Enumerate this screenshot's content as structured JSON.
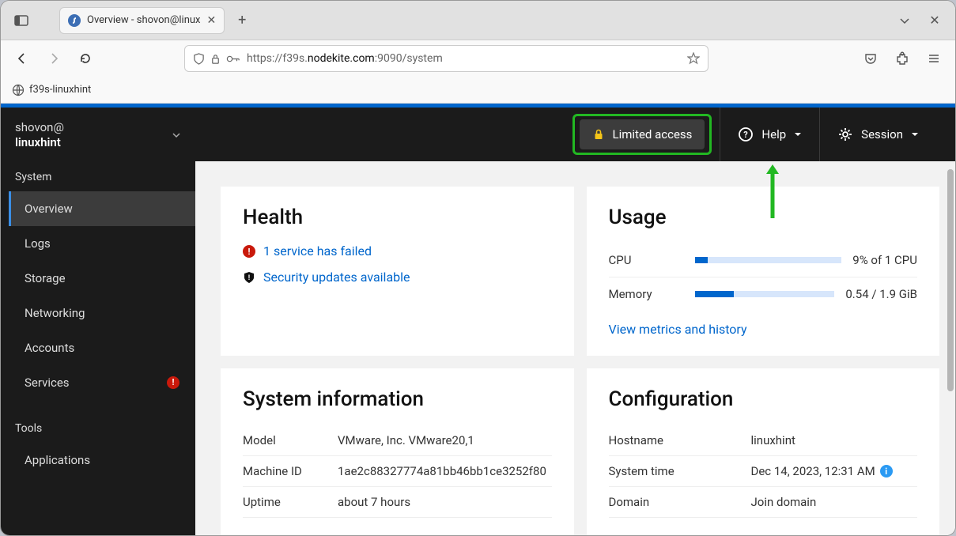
{
  "browser": {
    "tab_title": "Overview - shovon@linux",
    "url_prefix": "https://f39s.",
    "url_host": "nodekite.com",
    "url_suffix": ":9090/system",
    "bookmark": "f39s-linuxhint"
  },
  "sidebar": {
    "user_line1": "shovon@",
    "user_line2": "linuxhint",
    "section_system": "System",
    "items": [
      {
        "label": "Overview"
      },
      {
        "label": "Logs"
      },
      {
        "label": "Storage"
      },
      {
        "label": "Networking"
      },
      {
        "label": "Accounts"
      },
      {
        "label": "Services",
        "badge": "!"
      }
    ],
    "section_tools": "Tools",
    "tools": [
      {
        "label": "Applications"
      }
    ]
  },
  "topbar": {
    "limited": "Limited access",
    "help": "Help",
    "session": "Session"
  },
  "health": {
    "title": "Health",
    "failed": "1 service has failed",
    "security": "Security updates available"
  },
  "usage": {
    "title": "Usage",
    "cpu_label": "CPU",
    "cpu_value": "9% of 1 CPU",
    "cpu_pct": 9,
    "mem_label": "Memory",
    "mem_value": "0.54 / 1.9 GiB",
    "mem_pct": 28,
    "metrics_link": "View metrics and history"
  },
  "sysinfo": {
    "title": "System information",
    "rows": [
      {
        "label": "Model",
        "value": "VMware, Inc. VMware20,1"
      },
      {
        "label": "Machine ID",
        "value": "1ae2c88327774a81bb46bb1ce3252f80"
      },
      {
        "label": "Uptime",
        "value": "about 7 hours"
      }
    ]
  },
  "config": {
    "title": "Configuration",
    "rows": [
      {
        "label": "Hostname",
        "value": "linuxhint"
      },
      {
        "label": "System time",
        "value": "Dec 14, 2023, 12:31 AM"
      },
      {
        "label": "Domain",
        "value": "Join domain"
      }
    ]
  }
}
